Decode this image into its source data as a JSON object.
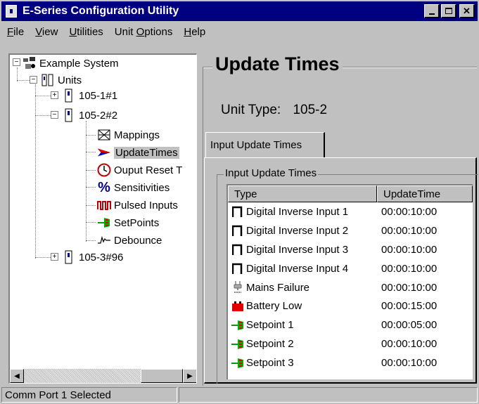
{
  "window": {
    "title": "E-Series Configuration Utility"
  },
  "menu": [
    {
      "label": "File",
      "u": "F",
      "rest": "ile"
    },
    {
      "label": "View",
      "u": "V",
      "rest": "iew"
    },
    {
      "label": "Utilities",
      "u": "U",
      "rest": "tilities"
    },
    {
      "label": "Unit Options",
      "pre": "Unit ",
      "u": "O",
      "rest": "ptions"
    },
    {
      "label": "Help",
      "u": "H",
      "rest": "elp"
    }
  ],
  "tree": {
    "root": "Example System",
    "units": "Units",
    "unit1": "105-1#1",
    "unit2": "105-2#2",
    "children": [
      "Mappings",
      "UpdateTimes",
      "Ouput Reset T",
      "Sensitivities",
      "Pulsed Inputs",
      "SetPoints",
      "Debounce"
    ],
    "unit3": "105-3#96"
  },
  "panel": {
    "title": "Update Times",
    "unit_type_label": "Unit Type:",
    "unit_type_value": "105-2",
    "tab_label": "Input Update Times",
    "group_label": "Input Update Times"
  },
  "table": {
    "headers": [
      "Type",
      "UpdateTime"
    ],
    "rows": [
      {
        "icon": "pulse-icon",
        "type": "Digital Inverse Input 1",
        "time": "00:00:10:00"
      },
      {
        "icon": "pulse-icon",
        "type": "Digital Inverse Input 2",
        "time": "00:00:10:00"
      },
      {
        "icon": "pulse-icon",
        "type": "Digital Inverse Input 3",
        "time": "00:00:10:00"
      },
      {
        "icon": "pulse-icon",
        "type": "Digital Inverse Input 4",
        "time": "00:00:10:00"
      },
      {
        "icon": "plug-icon",
        "type": "Mains Failure",
        "time": "00:00:10:00"
      },
      {
        "icon": "battery-icon",
        "type": "Battery Low",
        "time": "00:00:15:00"
      },
      {
        "icon": "setpoint-icon",
        "type": "Setpoint 1",
        "time": "00:00:05:00"
      },
      {
        "icon": "setpoint-icon",
        "type": "Setpoint 2",
        "time": "00:00:10:00"
      },
      {
        "icon": "setpoint-icon",
        "type": "Setpoint 3",
        "time": "00:00:10:00"
      }
    ]
  },
  "status": {
    "text": "Comm Port 1 Selected"
  },
  "colors": {
    "titlebar": "#000080",
    "face": "#c0c0c0",
    "setpoint_green": "#00b000",
    "setpoint_red": "#e00000"
  }
}
